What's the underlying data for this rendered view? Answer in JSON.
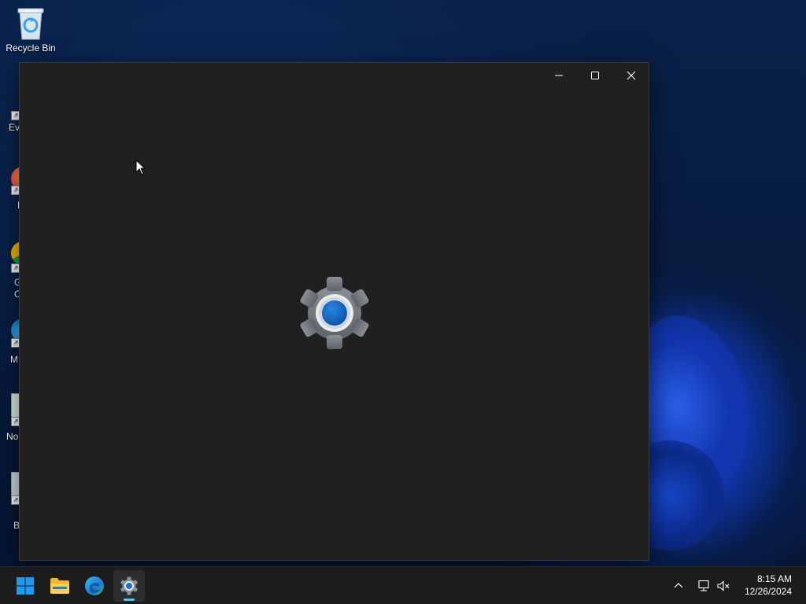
{
  "desktop": {
    "icons": [
      {
        "label": "Recycle Bin"
      }
    ],
    "partial_labels": [
      "Eve",
      "F",
      "G",
      "C",
      "M",
      "No",
      "B"
    ]
  },
  "window": {
    "title": "",
    "splash_icon": "gear-icon",
    "accent_color": "#1a6fd1"
  },
  "taskbar": {
    "apps": [
      {
        "name": "start-button",
        "icon": "windows-logo-icon"
      },
      {
        "name": "file-explorer",
        "icon": "folder-icon"
      },
      {
        "name": "microsoft-edge",
        "icon": "edge-icon"
      },
      {
        "name": "settings",
        "icon": "gear-icon",
        "active": true
      }
    ],
    "clock": {
      "time": "8:15 AM",
      "date": "12/26/2024"
    }
  }
}
